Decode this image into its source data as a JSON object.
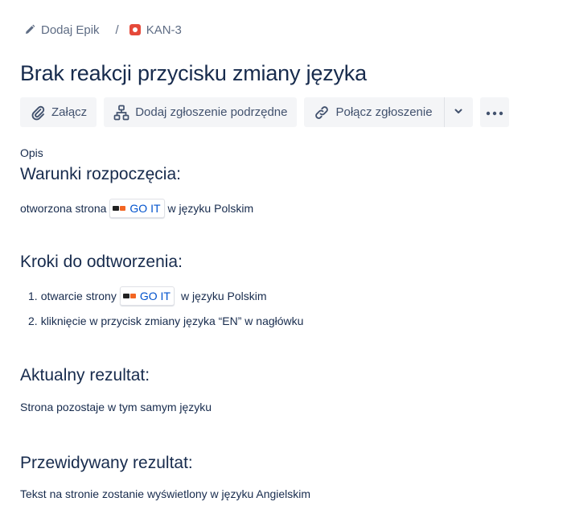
{
  "breadcrumb": {
    "epic_label": "Dodaj Epik",
    "separator": "/",
    "issue_key": "KAN-3"
  },
  "issue": {
    "title": "Brak reakcji przycisku zmiany języka"
  },
  "toolbar": {
    "attach_label": "Załącz",
    "add_child_label": "Dodaj zgłoszenie podrzędne",
    "link_issue_label": "Połącz zgłoszenie"
  },
  "description": {
    "label": "Opis",
    "preconditions_heading": "Warunki rozpoczęcia:",
    "preconditions_before": "otworzona strona",
    "preconditions_link": "GO IT",
    "preconditions_after": "w języku Polskim",
    "steps_heading": "Kroki do odtworzenia:",
    "steps": [
      {
        "num": "1.",
        "before": "otwarcie strony",
        "link": "GO IT",
        "after": "w języku Polskim"
      },
      {
        "num": "2.",
        "text": "kliknięcie w przycisk zmiany języka “EN” w nagłówku"
      }
    ],
    "actual_heading": "Aktualny rezultat:",
    "actual_text": "Strona pozostaje w tym samym języku",
    "expected_heading": "Przewidywany rezultat:",
    "expected_text": "Tekst na stronie zostanie wyświetlony w języku Angielskim"
  },
  "colors": {
    "text": "#172b4d",
    "subtle": "#5e6c84",
    "button_bg": "#f4f5f7",
    "link": "#0052cc",
    "bug_red": "#e5493a"
  },
  "icons": {
    "epic": "pencil-icon",
    "issue_type": "bug-icon",
    "attach": "paperclip-icon",
    "add_child": "hierarchy-icon",
    "link_issue": "link-icon",
    "dropdown": "chevron-down-icon",
    "more": "more-icon"
  }
}
